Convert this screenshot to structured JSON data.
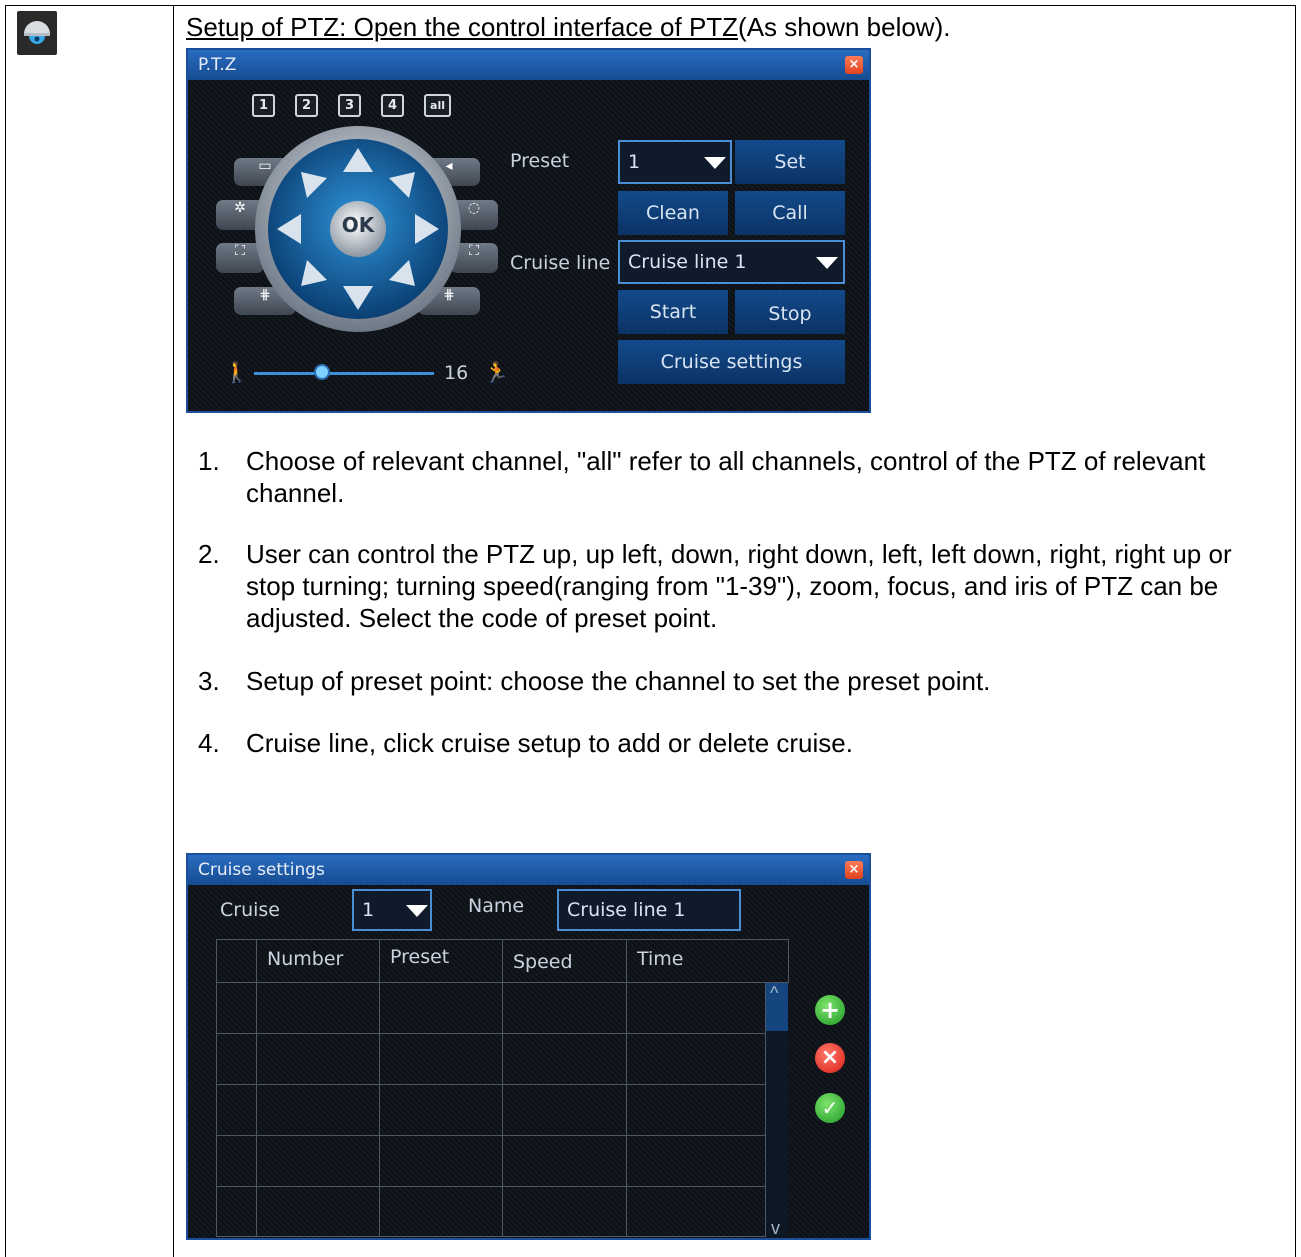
{
  "intro": {
    "prefix": "Setup of PTZ: Open the control interface of PTZ",
    "suffix": "(As shown below)."
  },
  "ptz_dialog": {
    "title": "P.T.Z",
    "close": "×",
    "channels": [
      "1",
      "2",
      "3",
      "4",
      "all"
    ],
    "center_label": "OK",
    "preset_label": "Preset",
    "preset_value": "1",
    "set_button": "Set",
    "clean_button": "Clean",
    "call_button": "Call",
    "cruise_line_label": "Cruise line",
    "cruise_line_value": "Cruise line 1",
    "start_button": "Start",
    "stop_button": "Stop",
    "cruise_settings_button": "Cruise settings",
    "speed_value": "16",
    "speed_fraction": 0.38
  },
  "instructions": [
    {
      "num": "1.",
      "text": "Choose of relevant channel, \"all\" refer to all channels, control of the PTZ of relevant channel."
    },
    {
      "num": "2.",
      "text": "User can control the PTZ up, up left, down, right down, left, left down, right, right up or stop turning; turning speed(ranging from \"1-39\"), zoom, focus, and iris of PTZ can be adjusted. Select the code of preset point."
    },
    {
      "num": "3.",
      "text": "Setup of preset point: choose the channel to set the preset point."
    },
    {
      "num": "4.",
      "text": "Cruise line, click cruise setup to add or delete cruise."
    }
  ],
  "cruise_dialog": {
    "title": "Cruise settings",
    "close": "×",
    "cruise_label": "Cruise",
    "cruise_value": "1",
    "name_label": "Name",
    "name_value": "Cruise line 1",
    "columns": [
      "Number",
      "Preset",
      "Speed",
      "Time"
    ],
    "scroll_up": "^",
    "scroll_down": "v",
    "add_icon": "+",
    "delete_icon": "×",
    "confirm_icon": "✓"
  },
  "colors": {
    "dialog_bg": "#10141a",
    "title_bar": "#1a5aa8",
    "button": "#134a8a",
    "accent": "#4a8fd6"
  }
}
